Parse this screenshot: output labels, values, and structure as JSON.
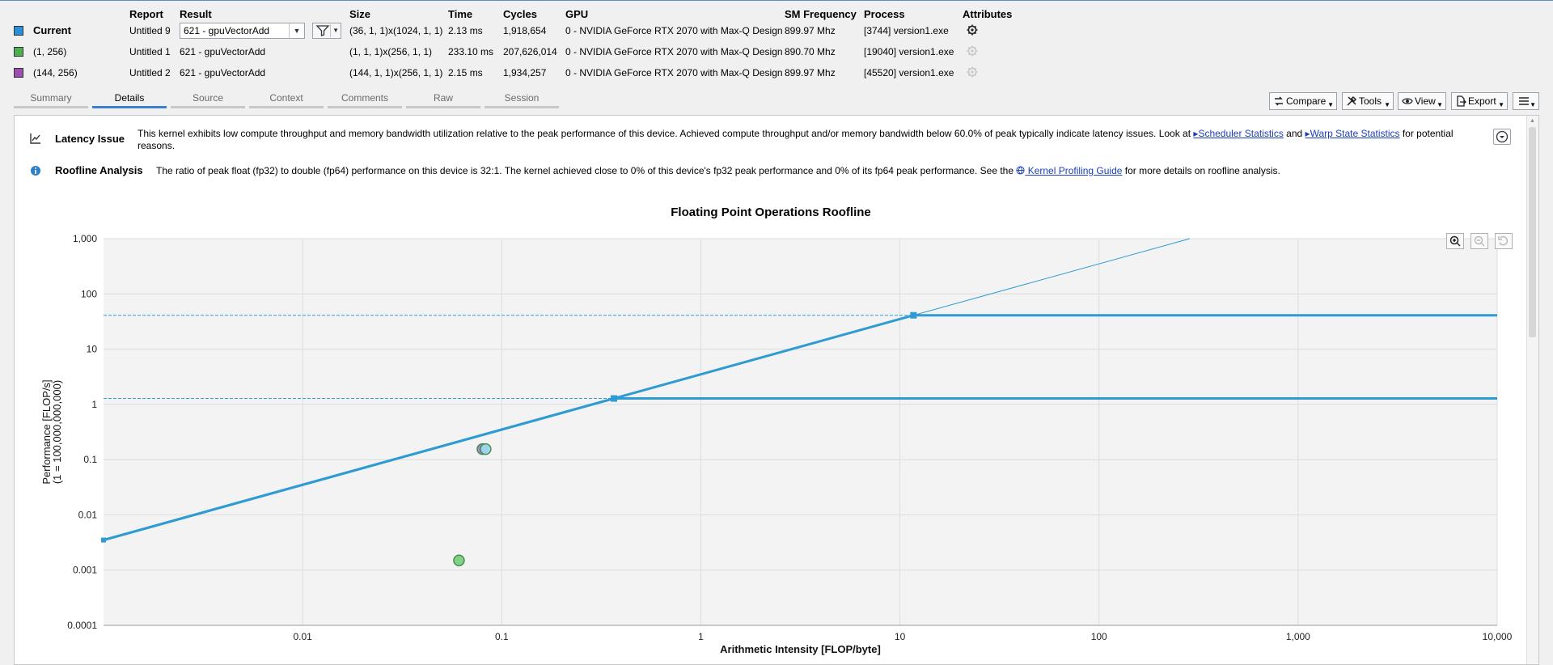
{
  "results": {
    "headers": {
      "report": "Report",
      "result": "Result",
      "size": "Size",
      "time": "Time",
      "cycles": "Cycles",
      "gpu": "GPU",
      "sm_frequency": "SM Frequency",
      "process": "Process",
      "attributes": "Attributes"
    },
    "rows": [
      {
        "name": "Current",
        "color": "#2a8fd6",
        "report": "Untitled 9",
        "result": "621 - gpuVectorAdd",
        "size": "(36, 1, 1)x(1024, 1, 1)",
        "time": "2.13 ms",
        "cycles": "1,918,654",
        "gpu": "0 - NVIDIA GeForce RTX 2070 with Max-Q Design",
        "sm_frequency": "899.97 Mhz",
        "process": "[3744] version1.exe",
        "icon": "gear-icon"
      },
      {
        "name": "(1, 256)",
        "color": "#4caf50",
        "report": "Untitled 1",
        "result": "621 - gpuVectorAdd",
        "size": "(1, 1, 1)x(256, 1, 1)",
        "time": "233.10 ms",
        "cycles": "207,626,014",
        "gpu": "0 - NVIDIA GeForce RTX 2070 with Max-Q Design",
        "sm_frequency": "890.70 Mhz",
        "process": "[19040] version1.exe",
        "icon": "gear-icon"
      },
      {
        "name": "(144, 256)",
        "color": "#9c4fb0",
        "report": "Untitled 2",
        "result": "621 - gpuVectorAdd",
        "size": "(144, 1, 1)x(256, 1, 1)",
        "time": "2.15 ms",
        "cycles": "1,934,257",
        "gpu": "0 - NVIDIA GeForce RTX 2070 with Max-Q Design",
        "sm_frequency": "899.97 Mhz",
        "process": "[45520] version1.exe",
        "icon": "gear-icon"
      }
    ]
  },
  "tabs": [
    "Summary",
    "Details",
    "Source",
    "Context",
    "Comments",
    "Raw",
    "Session"
  ],
  "active_tab": "Details",
  "toolbar": {
    "compare": "Compare",
    "tools": "Tools",
    "view": "View",
    "export": "Export"
  },
  "latency": {
    "title": "Latency Issue",
    "text_a": "This kernel exhibits low compute throughput and memory bandwidth utilization relative to the peak performance of this device. Achieved compute throughput and/or memory bandwidth below 60.0% of peak typically indicate latency issues. Look at ",
    "link1": "Scheduler Statistics",
    "text_b": " and ",
    "link2": "Warp State Statistics",
    "text_c": " for potential reasons."
  },
  "roofline_analysis": {
    "title": "Roofline Analysis",
    "text_a": "The ratio of peak float (fp32) to double (fp64) performance on this device is 32:1. The kernel achieved close to 0% of this device's fp32 peak performance and 0% of its fp64 peak performance. See the ",
    "link": "Kernel Profiling Guide",
    "text_b": " for more details on roofline analysis."
  },
  "chart_data": {
    "type": "scatter",
    "title": "Floating Point Operations Roofline",
    "xlabel": "Arithmetic Intensity [FLOP/byte]",
    "ylabel": "Performance [FLOP/s]",
    "ylabel2": "(1 = 100,000,000,000)",
    "x_scale": "log",
    "y_scale": "log",
    "xlim": [
      0.001,
      10000
    ],
    "ylim": [
      0.0001,
      1000
    ],
    "x_ticks": [
      0.01,
      0.1,
      1,
      10,
      100,
      1000,
      10000
    ],
    "x_tick_labels": [
      "0.01",
      "0.1",
      "1",
      "10",
      "100",
      "1,000",
      "10,000"
    ],
    "y_ticks": [
      0.0001,
      0.001,
      0.01,
      0.1,
      1,
      10,
      100,
      1000
    ],
    "y_tick_labels": [
      "0.0001",
      "0.001",
      "0.01",
      "0.1",
      "1",
      "10",
      "100",
      "1,000"
    ],
    "grid": true,
    "rooflines": [
      {
        "bandwidth_slope": 3.5,
        "peak": 41,
        "ridge_x": 11.7,
        "color": "#2f9bd3"
      },
      {
        "bandwidth_slope": 3.5,
        "peak": 1.28,
        "ridge_x": 0.366,
        "color": "#2f9bd3"
      }
    ],
    "points": [
      {
        "series": "(1, 256)",
        "x": 0.061,
        "y": 0.0015,
        "color": "#7dd07f"
      },
      {
        "series": "(144, 256)",
        "x": 0.08,
        "y": 0.155,
        "color": "#b07fd0"
      },
      {
        "series": "Current",
        "x": 0.083,
        "y": 0.155,
        "color": "#9fd8f0"
      }
    ]
  }
}
